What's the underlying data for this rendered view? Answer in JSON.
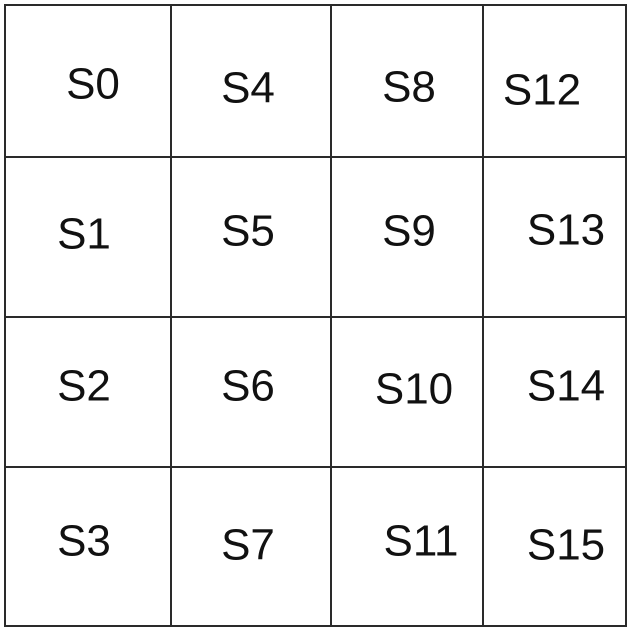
{
  "grid": {
    "rows": 4,
    "cols": 4,
    "cells": [
      [
        "S0",
        "S4",
        "S8",
        "S12"
      ],
      [
        "S1",
        "S5",
        "S9",
        "S13"
      ],
      [
        "S2",
        "S6",
        "S10",
        "S14"
      ],
      [
        "S3",
        "S7",
        "S11",
        "S15"
      ]
    ]
  }
}
